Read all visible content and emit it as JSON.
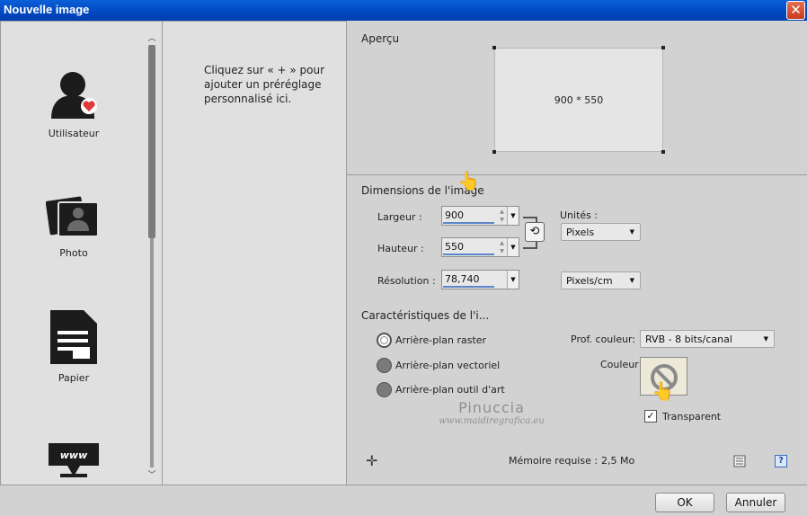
{
  "window": {
    "title": "Nouvelle image",
    "close_glyph": "✕"
  },
  "presets": [
    {
      "label": "Utilisateur",
      "icon": "user-heart-icon"
    },
    {
      "label": "Photo",
      "icon": "photo-icon"
    },
    {
      "label": "Papier",
      "icon": "paper-icon"
    },
    {
      "label": "",
      "icon": "web-icon"
    }
  ],
  "scroll": {
    "up": "︿",
    "down": "﹀"
  },
  "custom": {
    "hint": "Cliquez sur « + » pour ajouter un préréglage personnalisé ici."
  },
  "preview": {
    "title": "Aperçu",
    "dimensions": "900 * 550"
  },
  "dimensions": {
    "title": "Dimensions de l'image",
    "width_label": "Largeur :",
    "width_value": "900",
    "height_label": "Hauteur :",
    "height_value": "550",
    "resolution_label": "Résolution :",
    "resolution_value": "78,740",
    "units_label": "Unités :",
    "units_value": "Pixels",
    "resolution_units_value": "Pixels/cm",
    "link_glyph": "⟲"
  },
  "characteristics": {
    "title": "Caractéristiques de l'i...",
    "options": [
      {
        "label": "Arrière-plan raster",
        "selected": true
      },
      {
        "label": "Arrière-plan vectoriel",
        "selected": false
      },
      {
        "label": "Arrière-plan outil d'art",
        "selected": false
      }
    ],
    "color_depth_label": "Prof. couleur:",
    "color_depth_value": "RVB - 8 bits/canal",
    "color_label": "Couleur :",
    "transparent_label": "Transparent",
    "transparent_checked": true,
    "check_glyph": "✓"
  },
  "footer": {
    "add_glyph": "✛",
    "memory_label": "Mémoire requise :",
    "memory_value": "2,5 Mo",
    "help_glyph": "?"
  },
  "buttons": {
    "ok": "OK",
    "cancel": "Annuler"
  },
  "watermark": {
    "name": "Pinuccia",
    "url": "www.maidiregrafica.eu"
  },
  "pointer_glyph": "👆",
  "colors": {
    "titlebar": "#0148c0",
    "panel": "#e0e0e0",
    "dialog": "#d2d2d2"
  }
}
